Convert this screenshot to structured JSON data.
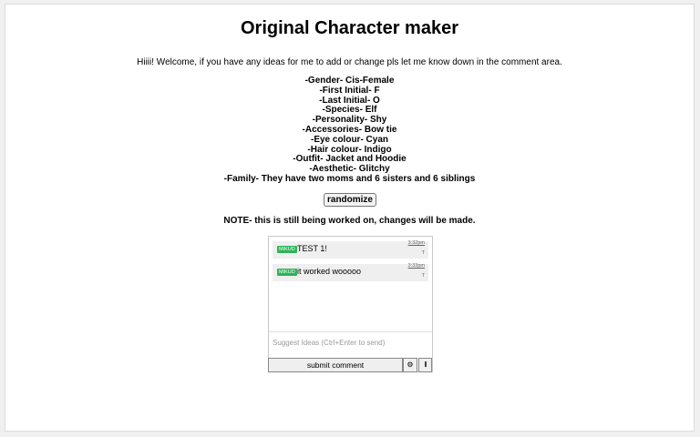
{
  "page": {
    "title": "Original Character maker",
    "welcome": "Hiiii! Welcome, if you have any ideas for me to add or change pls let me know down in the comment area.",
    "traits": [
      "-Gender- Cis-Female",
      "-First Initial- F",
      "-Last Initial- O",
      "-Species- Elf",
      "-Personality- Shy",
      "-Accessories- Bow tie",
      "-Eye colour- Cyan",
      "-Hair colour- Indigo",
      "-Outfit- Jacket and Hoodie",
      "-Aesthetic- Glitchy",
      "-Family- They have two moms and 6 sisters and 6 siblings"
    ],
    "randomize_label": "randomize",
    "note": "NOTE- this is still being worked on, changes will be made."
  },
  "comments": {
    "messages": [
      {
        "badge": "MIKUD",
        "text": "TEST 1!",
        "time": "3:32pm",
        "flag": "T"
      },
      {
        "badge": "MIKUD",
        "text": "it worked wooooo",
        "time": "3:33pm",
        "flag": "T"
      }
    ],
    "placeholder": "Suggest Ideas (Ctrl+Enter to send)",
    "submit_label": "submit comment",
    "settings_icon": "gear-icon",
    "extra_icon": "bar-icon"
  },
  "colors": {
    "badge": "#2fb35a",
    "message_bg": "#efefef"
  }
}
